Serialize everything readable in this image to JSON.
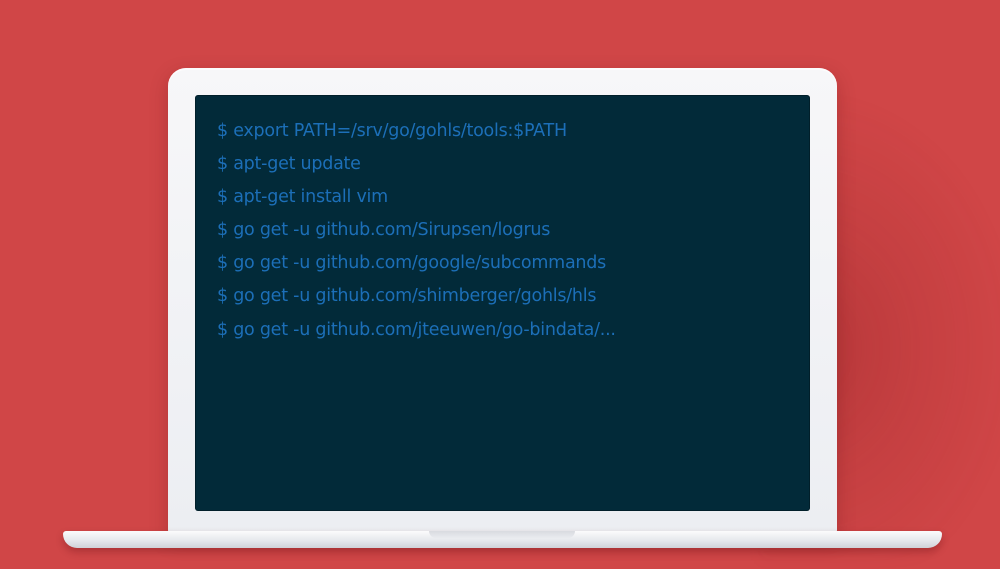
{
  "terminal": {
    "lines": [
      "$ export PATH=/srv/go/gohls/tools:$PATH",
      "$ apt-get update",
      "$ apt-get install vim",
      "$ go get -u github.com/Sirupsen/logrus",
      "$ go get -u github.com/google/subcommands",
      "$ go get -u github.com/shimberger/gohls/hls",
      "$ go get -u github.com/jteeuwen/go-bindata/..."
    ]
  },
  "colors": {
    "background": "#d04647",
    "screen": "#022a39",
    "terminal_text": "#1c6fb8",
    "laptop_body": "#eceef2"
  }
}
